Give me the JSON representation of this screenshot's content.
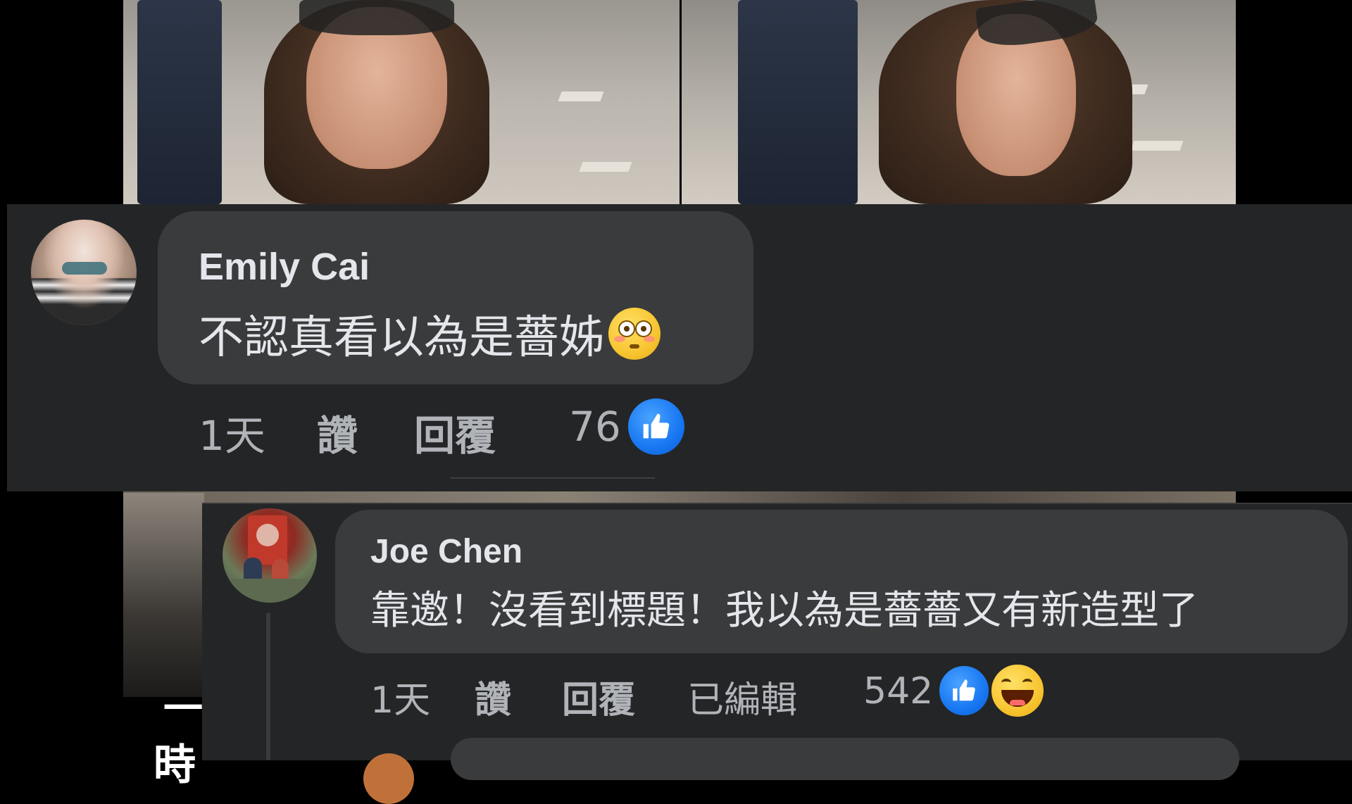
{
  "colors": {
    "panel_bg": "#242526",
    "bubble_bg": "#3a3b3c",
    "text_primary": "#e4e6eb",
    "text_secondary": "#b0b3b8",
    "like_blue": "#1877f2"
  },
  "comments": [
    {
      "author": "Emily Cai",
      "text": "不認真看以為是薔姊",
      "emoji": "flushed-face-icon",
      "time": "1天",
      "like_action": "讚",
      "reply_action": "回覆",
      "reaction_count": "76",
      "reactions": [
        "like-icon"
      ]
    },
    {
      "author": "Joe Chen",
      "text": "靠邀！沒看到標題！我以為是薔薔又有新造型了",
      "time": "1天",
      "like_action": "讚",
      "reply_action": "回覆",
      "edited_label": "已編輯",
      "reaction_count": "542",
      "reactions": [
        "like-icon",
        "haha-icon"
      ]
    }
  ],
  "background_caption": {
    "line1": "一",
    "line2": "時"
  }
}
